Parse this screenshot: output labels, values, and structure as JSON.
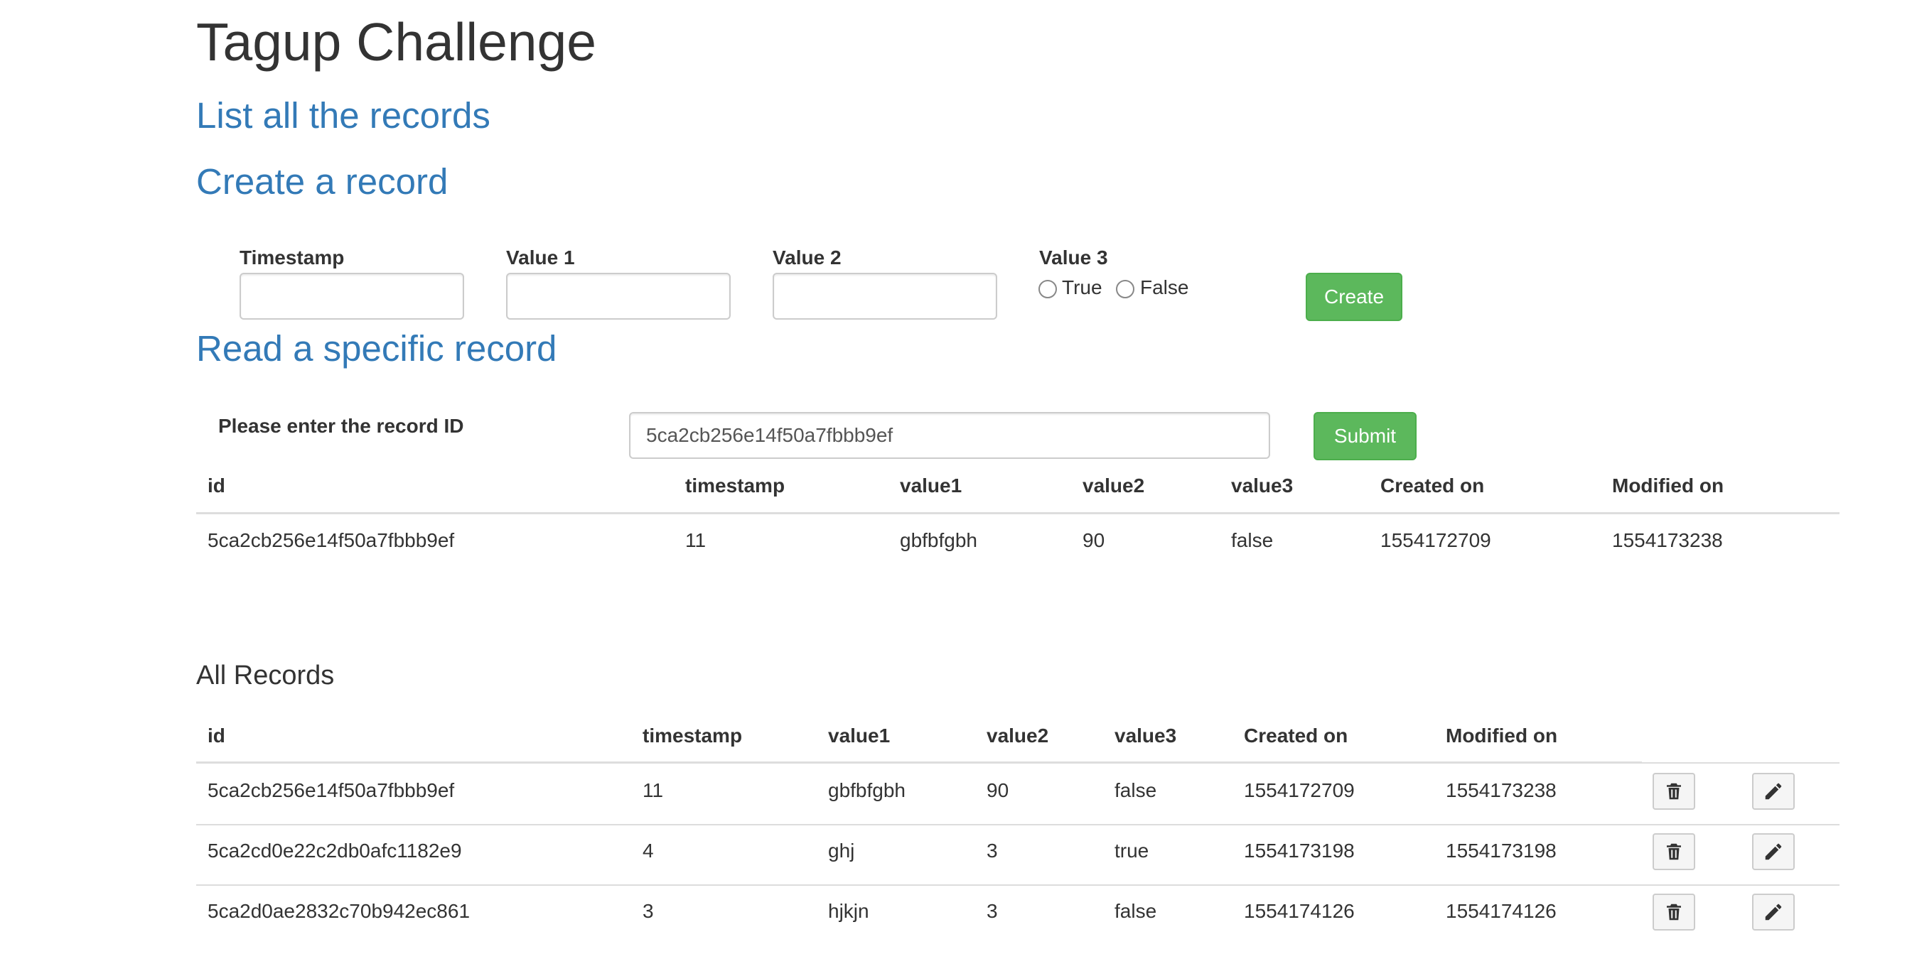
{
  "header": {
    "title": "Tagup Challenge"
  },
  "nav": {
    "list_all": "List all the records",
    "create": "Create a record",
    "read": "Read a specific record"
  },
  "create_form": {
    "timestamp_label": "Timestamp",
    "timestamp_value": "",
    "value1_label": "Value 1",
    "value1_value": "",
    "value2_label": "Value 2",
    "value2_value": "",
    "value3_label": "Value 3",
    "value3_options": [
      "True",
      "False"
    ],
    "submit_label": "Create"
  },
  "read_form": {
    "id_label": "Please enter the record ID",
    "id_value": "5ca2cb256e14f50a7fbbb9ef",
    "submit_label": "Submit"
  },
  "read_result": {
    "columns": [
      "id",
      "timestamp",
      "value1",
      "value2",
      "value3",
      "Created on",
      "Modified on"
    ],
    "row": [
      "5ca2cb256e14f50a7fbbb9ef",
      "11",
      "gbfbfgbh",
      "90",
      "false",
      "1554172709",
      "1554173238"
    ]
  },
  "all_records": {
    "title": "All Records",
    "columns": [
      "id",
      "timestamp",
      "value1",
      "value2",
      "value3",
      "Created on",
      "Modified on"
    ],
    "rows": [
      [
        "5ca2cb256e14f50a7fbbb9ef",
        "11",
        "gbfbfgbh",
        "90",
        "false",
        "1554172709",
        "1554173238"
      ],
      [
        "5ca2cd0e22c2db0afc1182e9",
        "4",
        "ghj",
        "3",
        "true",
        "1554173198",
        "1554173198"
      ],
      [
        "5ca2d0ae2832c70b942ec861",
        "3",
        "hjkjn",
        "3",
        "false",
        "1554174126",
        "1554174126"
      ]
    ],
    "row_actions": [
      "trash-icon",
      "pencil-icon"
    ]
  },
  "colors": {
    "link": "#337ab7",
    "success": "#5cb85c",
    "text": "#333333",
    "rule": "#dddddd"
  }
}
